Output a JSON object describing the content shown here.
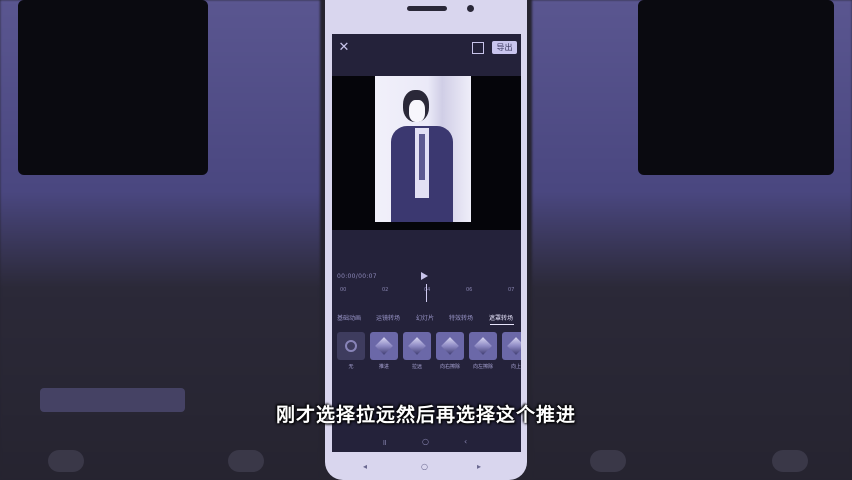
{
  "editor": {
    "export_label": "导出",
    "timecode": "00:00/00:07",
    "timeline_ticks": [
      "00",
      "02",
      "04",
      "06",
      "07"
    ],
    "tabs": [
      {
        "label": "基础动画",
        "active": false
      },
      {
        "label": "运镜转场",
        "active": false
      },
      {
        "label": "幻灯片",
        "active": false
      },
      {
        "label": "特效转场",
        "active": false
      },
      {
        "label": "遮罩转场",
        "active": true
      }
    ],
    "effects": [
      {
        "label": "无",
        "icon": "none-icon"
      },
      {
        "label": "推进",
        "icon": "effect-thumb"
      },
      {
        "label": "拉远",
        "icon": "effect-thumb"
      },
      {
        "label": "向右擦除",
        "icon": "effect-thumb"
      },
      {
        "label": "向左擦除",
        "icon": "effect-thumb"
      },
      {
        "label": "向上",
        "icon": "effect-thumb"
      }
    ]
  },
  "subtitle": "刚才选择拉远然后再选择这个推进",
  "colors": {
    "accent": "#c9c5ee",
    "screen_bg": "#24223a",
    "background": "#262430"
  }
}
